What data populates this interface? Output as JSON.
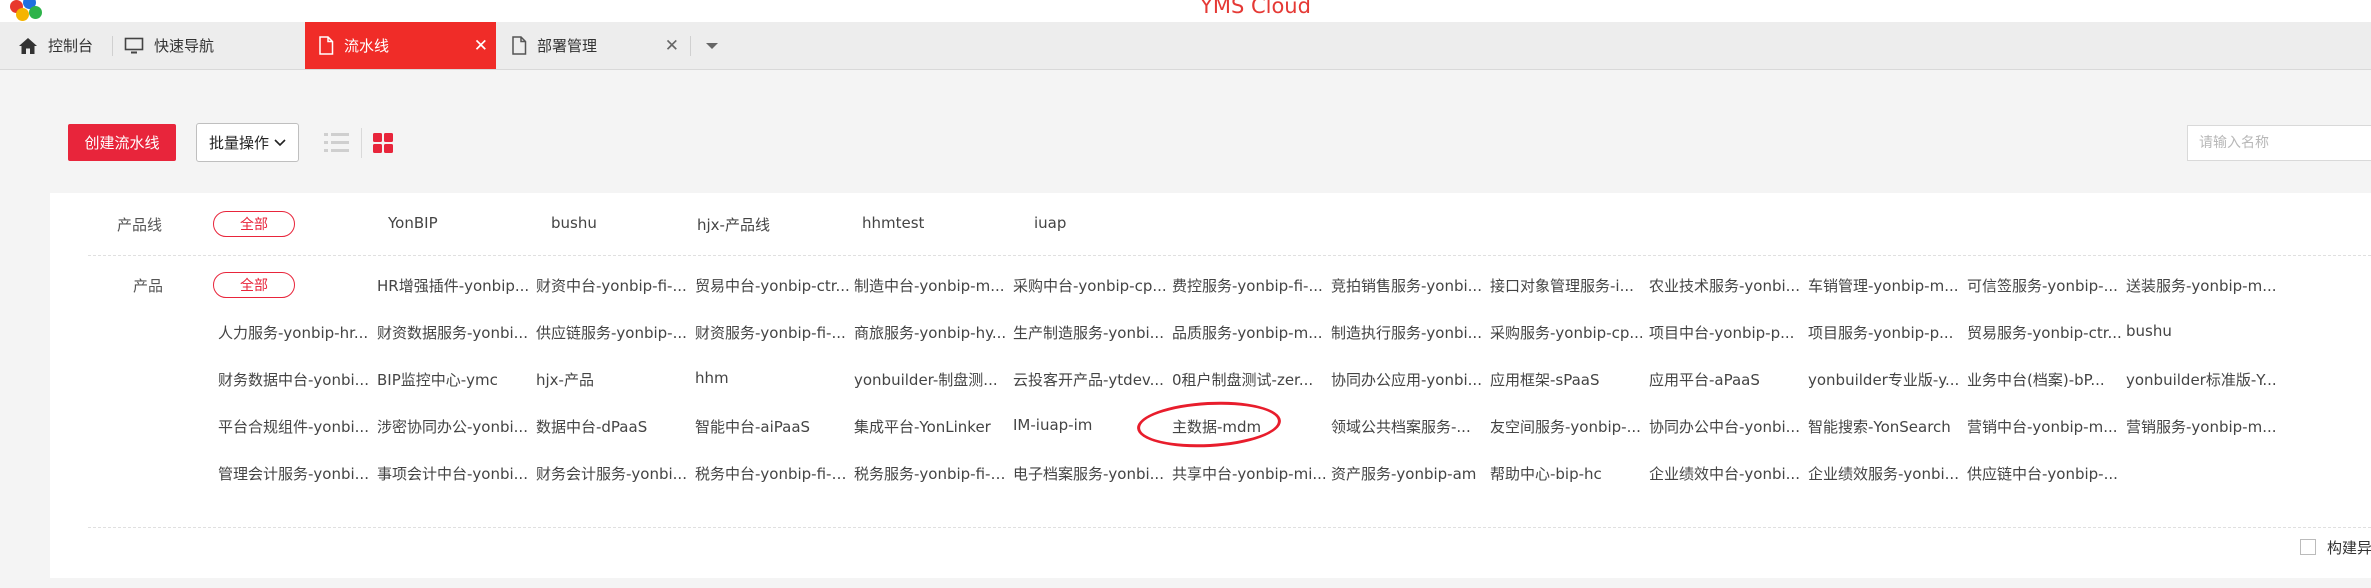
{
  "app": {
    "title": "YMS Cloud"
  },
  "tabs": [
    {
      "label": "控制台",
      "icon": "home-icon",
      "active": false,
      "closable": false
    },
    {
      "label": "快速导航",
      "icon": "monitor-icon",
      "active": false,
      "closable": false
    },
    {
      "label": "流水线",
      "icon": "document-icon",
      "active": true,
      "closable": true
    },
    {
      "label": "部署管理",
      "icon": "document-icon",
      "active": false,
      "closable": true
    }
  ],
  "toolbar": {
    "create_label": "创建流水线",
    "batch_label": "批量操作",
    "search_placeholder": "请输入名称",
    "list_view_icon": "list-icon",
    "grid_view_icon": "grid-icon"
  },
  "filters": {
    "product_line": {
      "label": "产品线",
      "all_label": "全部",
      "items": [
        "YonBIP",
        "bushu",
        "hjx-产品线",
        "hhmtest",
        "iuap"
      ]
    },
    "product": {
      "label": "产品",
      "all_label": "全部",
      "rows": [
        [
          "HR增强插件-yonbip...",
          "财资中台-yonbip-fi-...",
          "贸易中台-yonbip-ctr...",
          "制造中台-yonbip-m...",
          "采购中台-yonbip-cp...",
          "费控服务-yonbip-fi-...",
          "竞拍销售服务-yonbi...",
          "接口对象管理服务-i...",
          "农业技术服务-yonbi...",
          "车销管理-yonbip-m...",
          "可信签服务-yonbip-...",
          "送装服务-yonbip-m..."
        ],
        [
          "人力服务-yonbip-hr...",
          "财资数据服务-yonbi...",
          "供应链服务-yonbip-...",
          "财资服务-yonbip-fi-...",
          "商旅服务-yonbip-hy...",
          "生产制造服务-yonbi...",
          "品质服务-yonbip-m...",
          "制造执行服务-yonbi...",
          "采购服务-yonbip-cp...",
          "项目中台-yonbip-p...",
          "项目服务-yonbip-p...",
          "贸易服务-yonbip-ctr...",
          "bushu"
        ],
        [
          "财务数据中台-yonbi...",
          "BIP监控中心-ymc",
          "hjx-产品",
          "hhm",
          "yonbuilder-制盘测...",
          "云投客开产品-ytdev...",
          "0租户制盘测试-zer...",
          "协同办公应用-yonbi...",
          "应用框架-sPaaS",
          "应用平台-aPaaS",
          "yonbuilder专业版-y...",
          "业务中台(档案)-bP...",
          "yonbuilder标准版-Y..."
        ],
        [
          "平台合规组件-yonbi...",
          "涉密协同办公-yonbi...",
          "数据中台-dPaaS",
          "智能中台-aiPaaS",
          "集成平台-YonLinker",
          "IM-iuap-im",
          "主数据-mdm",
          "领域公共档案服务-...",
          "友空间服务-yonbip-...",
          "协同办公中台-yonbi...",
          "智能搜索-YonSearch",
          "营销中台-yonbip-m...",
          "营销服务-yonbip-m..."
        ],
        [
          "管理会计服务-yonbi...",
          "事项会计中台-yonbi...",
          "财务会计服务-yonbi...",
          "税务中台-yonbip-fi-t...",
          "税务服务-yonbip-fi-t...",
          "电子档案服务-yonbi...",
          "共享中台-yonbip-mi...",
          "资产服务-yonbip-am",
          "帮助中心-bip-hc",
          "企业绩效中台-yonbi...",
          "企业绩效服务-yonbi...",
          "供应链中台-yonbip-..."
        ]
      ]
    }
  },
  "footer": {
    "checkbox_label": "构建异"
  },
  "colors": {
    "accent": "#e8253b",
    "tab_active": "#f02c28",
    "title": "#e53935"
  }
}
